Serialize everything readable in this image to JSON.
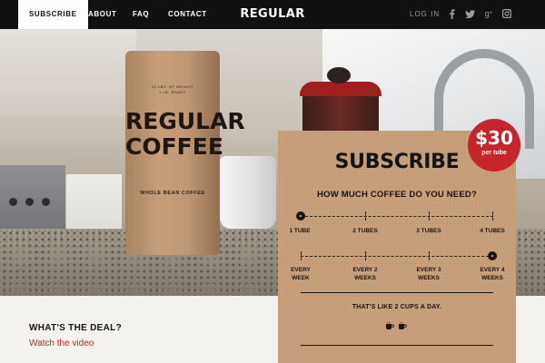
{
  "nav": {
    "items": [
      {
        "label": "SUBSCRIBE",
        "active": true
      },
      {
        "label": "ABOUT"
      },
      {
        "label": "FAQ"
      },
      {
        "label": "CONTACT"
      }
    ],
    "brand": "REGULAR COFFEE",
    "login": "LOG IN",
    "social": [
      "facebook-icon",
      "twitter-icon",
      "google-plus-icon",
      "instagram-icon"
    ]
  },
  "product": {
    "can_text_top": "12 LBS. NT WEIGHT",
    "can_text_top2": "1 LB. ROAST",
    "can_title_line1": "REGULAR",
    "can_title_line2": "COFFEE",
    "can_subtitle": "WHOLE BEAN COFFEE"
  },
  "subscribe": {
    "title": "SUBSCRIBE",
    "price": "$30",
    "price_unit": "per tube",
    "question": "HOW MUCH COFFEE DO YOU NEED?",
    "quantity_options": [
      "1 TUBE",
      "2 TUBES",
      "3 TUBES",
      "4 TUBES"
    ],
    "quantity_selected_index": 0,
    "frequency_options": [
      {
        "line1": "EVERY",
        "line2": "WEEK"
      },
      {
        "line1": "EVERY 2",
        "line2": "WEEKS"
      },
      {
        "line1": "EVERY 3",
        "line2": "WEEKS"
      },
      {
        "line1": "EVERY 4",
        "line2": "WEEKS"
      }
    ],
    "frequency_selected_index": 3,
    "note": "THAT'S LIKE 2 CUPS A DAY.",
    "cups": 2
  },
  "deal": {
    "title": "WHAT'S THE DEAL?",
    "link": "Watch the video"
  },
  "colors": {
    "nav_bg": "#111111",
    "accent_red": "#c4262a",
    "kraft": "#c7a07a"
  }
}
